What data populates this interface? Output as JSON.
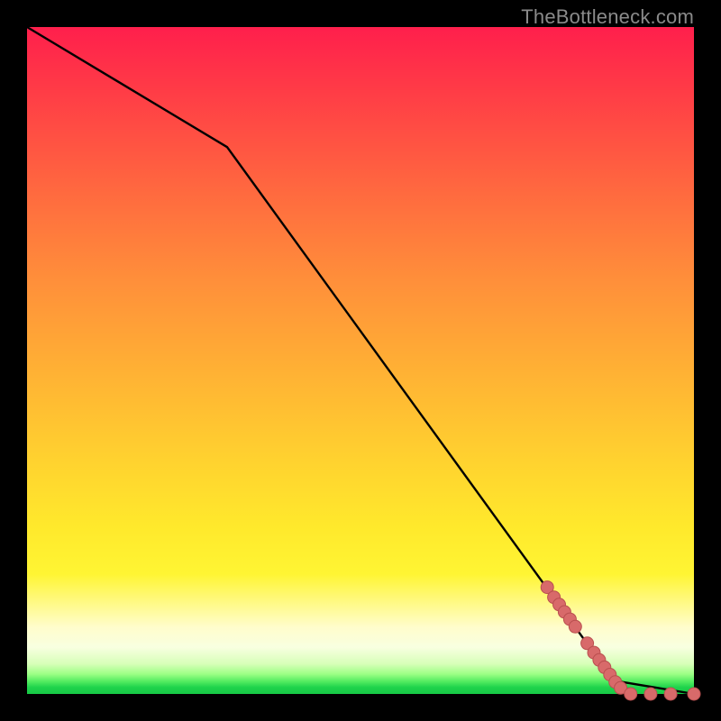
{
  "attribution": "TheBottleneck.com",
  "chart_data": {
    "type": "line",
    "title": "",
    "xlabel": "",
    "ylabel": "",
    "xlim": [
      0,
      100
    ],
    "ylim": [
      0,
      100
    ],
    "grid": false,
    "legend": false,
    "series": [
      {
        "name": "curve",
        "stroke": "#000000",
        "x": [
          0,
          30,
          88,
          100
        ],
        "values": [
          100,
          82,
          2,
          0
        ],
        "note": "piecewise-linear trace; slope change near x≈30, flattens near x≈88"
      }
    ],
    "markers": {
      "name": "highlighted-points",
      "fill": "#d86a6a",
      "stroke": "#b94f4f",
      "points": [
        {
          "x": 78.0,
          "y": 16.0
        },
        {
          "x": 79.0,
          "y": 14.5
        },
        {
          "x": 79.8,
          "y": 13.4
        },
        {
          "x": 80.6,
          "y": 12.3
        },
        {
          "x": 81.4,
          "y": 11.2
        },
        {
          "x": 82.2,
          "y": 10.1
        },
        {
          "x": 84.0,
          "y": 7.6
        },
        {
          "x": 85.0,
          "y": 6.2
        },
        {
          "x": 85.8,
          "y": 5.1
        },
        {
          "x": 86.6,
          "y": 4.0
        },
        {
          "x": 87.4,
          "y": 2.9
        },
        {
          "x": 88.2,
          "y": 1.8
        },
        {
          "x": 89.0,
          "y": 0.9
        },
        {
          "x": 90.5,
          "y": 0.0
        },
        {
          "x": 93.5,
          "y": 0.0
        },
        {
          "x": 96.5,
          "y": 0.0
        },
        {
          "x": 100.0,
          "y": 0.0
        }
      ]
    },
    "background_gradient": {
      "direction": "vertical",
      "stops": [
        {
          "pos": 0.0,
          "color": "#ff1f4c"
        },
        {
          "pos": 0.25,
          "color": "#ff6a3f"
        },
        {
          "pos": 0.52,
          "color": "#ffb234"
        },
        {
          "pos": 0.75,
          "color": "#ffe92c"
        },
        {
          "pos": 0.93,
          "color": "#f8ffe0"
        },
        {
          "pos": 1.0,
          "color": "#17c946"
        }
      ]
    }
  }
}
